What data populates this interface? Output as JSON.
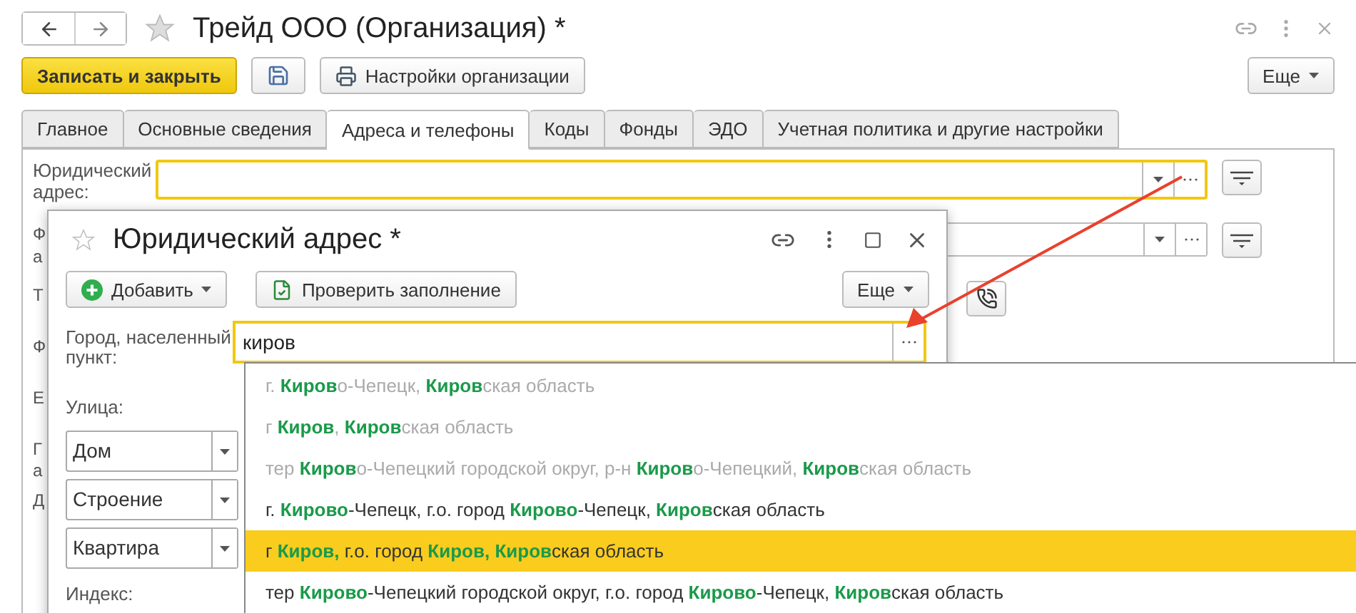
{
  "window": {
    "title": "Трейд ООО (Организация) *"
  },
  "toolbar": {
    "primary": "Записать и закрыть",
    "settings": "Настройки организации",
    "more": "Еще"
  },
  "tabs": [
    {
      "label": "Главное",
      "selected": false
    },
    {
      "label": "Основные сведения",
      "selected": false
    },
    {
      "label": "Адреса и телефоны",
      "selected": true
    },
    {
      "label": "Коды",
      "selected": false
    },
    {
      "label": "Фонды",
      "selected": false
    },
    {
      "label": "ЭДО",
      "selected": false
    },
    {
      "label": "Учетная политика и другие настройки",
      "selected": false
    }
  ],
  "fields": [
    {
      "label": "Юридический адрес:",
      "focused": true
    },
    {
      "focused": false
    }
  ],
  "covered_labels": [
    [
      "Т"
    ],
    [
      "Ф"
    ],
    [
      "Е"
    ],
    [
      "Г",
      "а"
    ],
    [
      "Д"
    ]
  ],
  "second_label_lines": [
    "Ф",
    "а"
  ],
  "popup": {
    "title": "Юридический адрес *",
    "add": "Добавить",
    "check": "Проверить заполнение",
    "more": "Еще",
    "city": {
      "label": "Город, населенный пункт:",
      "value": "киров",
      "focused": true
    },
    "street_label": "Улица:",
    "parts": [
      {
        "value": "Дом"
      },
      {
        "value": "Строение"
      },
      {
        "value": "Квартира"
      }
    ],
    "index_label": "Индекс:"
  },
  "suggestions": [
    {
      "text": "г. **Киров**о-Чепецк, **Киров**ская область",
      "dimmed": true,
      "selected": false
    },
    {
      "text": "г **Киров**, **Киров**ская область",
      "dimmed": true,
      "selected": false
    },
    {
      "text": "тер **Киров**о-Чепецкий городской округ, р-н **Киров**о-Чепецкий, **Киров**ская область",
      "dimmed": true,
      "selected": false
    },
    {
      "text": "г. **Кирово**-Чепецк, г.о. город **Кирово**-Чепецк, **Киров**ская область",
      "dimmed": false,
      "selected": false
    },
    {
      "text": "г **Киров,** г.о. город **Киров, Киров**ская область",
      "dimmed": false,
      "selected": true
    },
    {
      "text": "тер **Кирово**-Чепецкий городской округ, г.о. город **Кирово**-Чепецк, **Киров**ская область",
      "dimmed": false,
      "selected": false
    }
  ]
}
